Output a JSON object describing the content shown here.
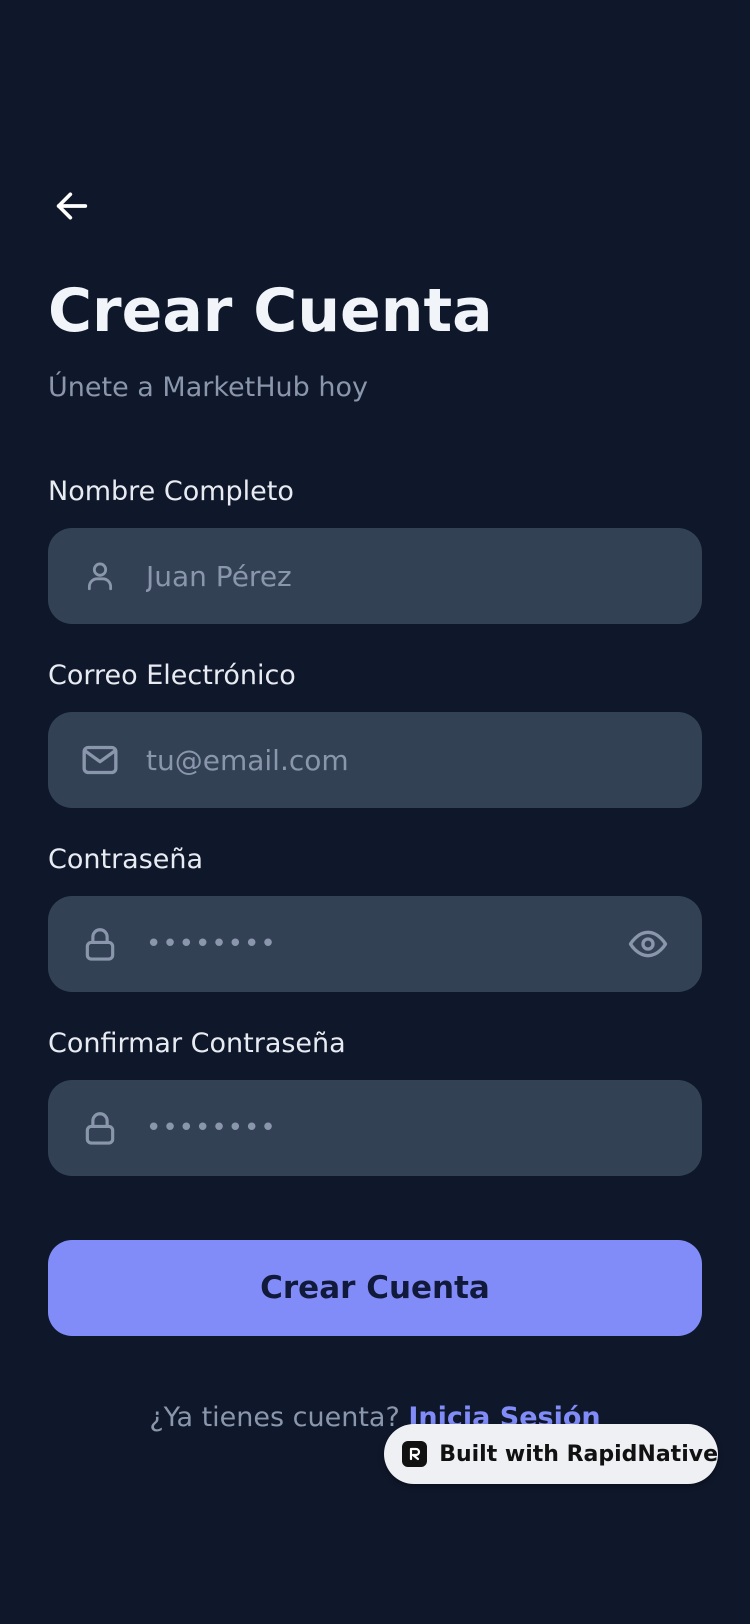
{
  "header": {
    "back_icon": "arrow-left-icon",
    "title": "Crear Cuenta",
    "subtitle": "Únete a MarketHub hoy"
  },
  "form": {
    "full_name": {
      "label": "Nombre Completo",
      "placeholder": "Juan Pérez",
      "icon": "user-icon"
    },
    "email": {
      "label": "Correo Electrónico",
      "placeholder": "tu@email.com",
      "icon": "mail-icon"
    },
    "password": {
      "label": "Contraseña",
      "value_masked": "••••••••",
      "icon": "lock-icon",
      "toggle_icon": "eye-icon"
    },
    "confirm_password": {
      "label": "Confirmar Contraseña",
      "value_masked": "••••••••",
      "icon": "lock-icon"
    },
    "submit_label": "Crear Cuenta"
  },
  "footer": {
    "prompt": "¿Ya tienes cuenta?",
    "link": "Inicia Sesión"
  },
  "badge": {
    "label": "Built with RapidNative"
  },
  "colors": {
    "background": "#0f172a",
    "input_background": "#334155",
    "accent": "#818cf8",
    "text_primary": "#f1f5f9",
    "text_muted": "#8a96ab"
  }
}
